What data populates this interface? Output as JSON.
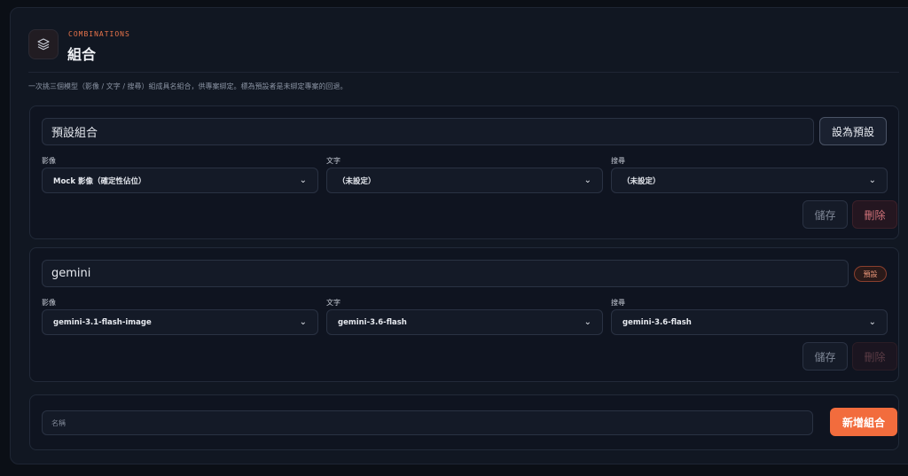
{
  "header": {
    "eyebrow": "COMBINATIONS",
    "title": "組合",
    "logo_icon": "layers-icon",
    "accent_color": "#e8734a"
  },
  "description": "一次挑三個模型（影像 / 文字 / 搜尋）組成具名組合，供專案綁定。標為預設者是未綁定專案的回退。",
  "labels": {
    "image": "影像",
    "text": "文字",
    "search": "搜尋",
    "save": "儲存",
    "delete": "刪除",
    "set_default": "設為預設",
    "default_badge": "預設",
    "add": "新增組合"
  },
  "combos": [
    {
      "name": "預設組合",
      "is_default": false,
      "image_model": "Mock 影像（確定性佔位）",
      "text_model": "（未設定）",
      "search_model": "（未設定）",
      "delete_enabled": true
    },
    {
      "name": "gemini",
      "is_default": true,
      "image_model": "gemini-3.1-flash-image",
      "text_model": "gemini-3.6-flash",
      "search_model": "gemini-3.6-flash",
      "delete_enabled": false
    }
  ],
  "new_combo": {
    "placeholder": "名稱",
    "button_color": "#f26c3d"
  }
}
